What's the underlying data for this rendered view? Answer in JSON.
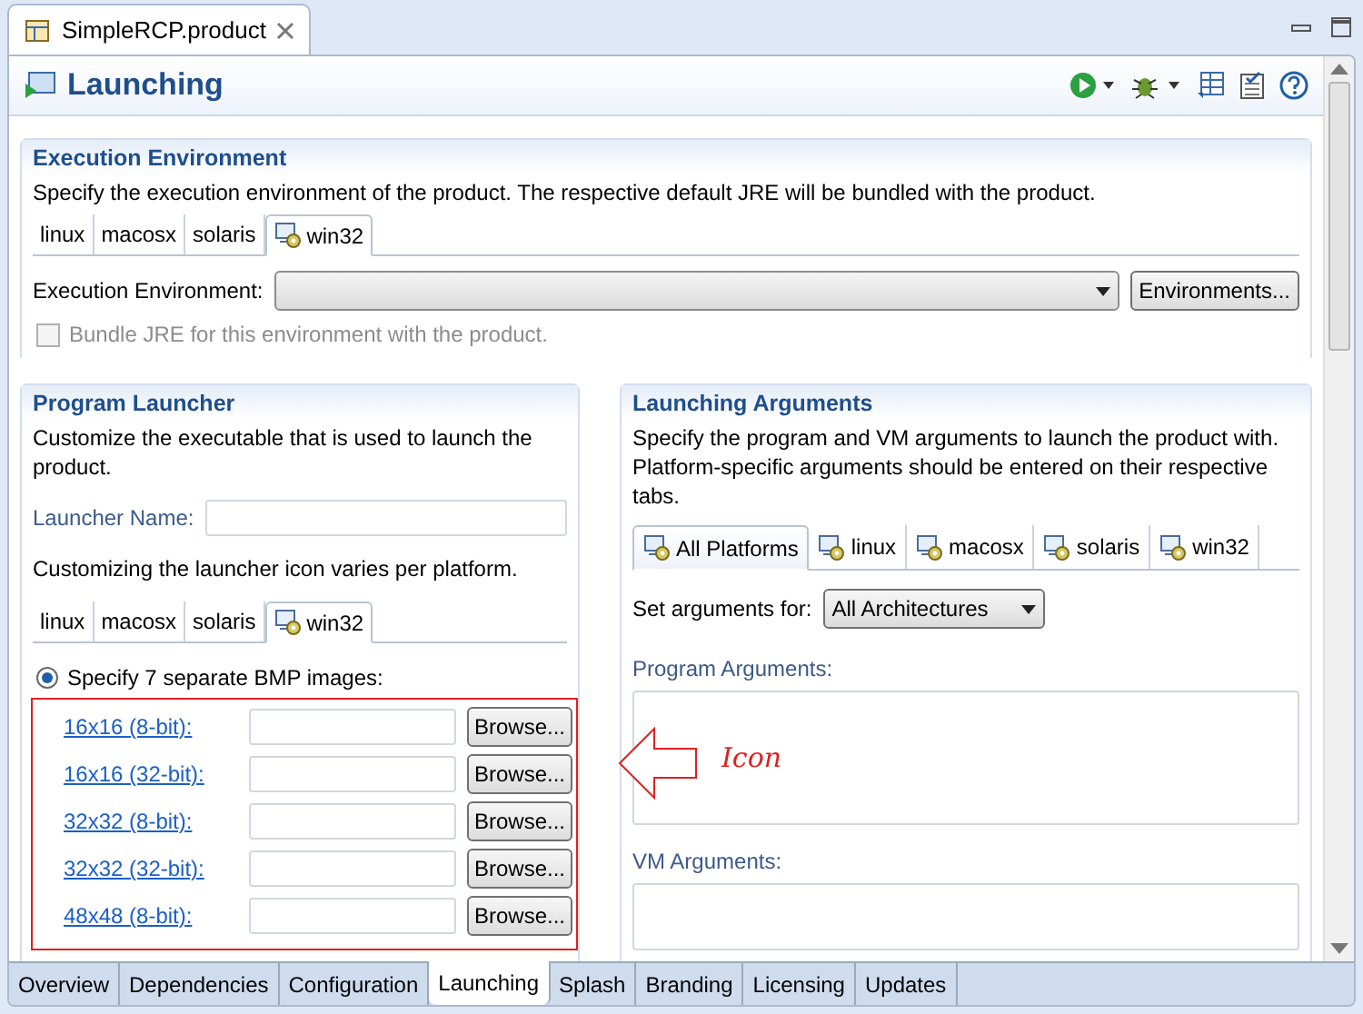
{
  "editor_tab": {
    "title": "SimpleRCP.product"
  },
  "form": {
    "title": "Launching"
  },
  "execution_environment": {
    "title": "Execution Environment",
    "description": "Specify the execution environment of the product. The respective default JRE will be bundled with the product.",
    "tabs": [
      {
        "label": "linux",
        "selected": false,
        "icon": false
      },
      {
        "label": "macosx",
        "selected": false,
        "icon": false
      },
      {
        "label": "solaris",
        "selected": false,
        "icon": false
      },
      {
        "label": "win32",
        "selected": true,
        "icon": true
      }
    ],
    "field_label": "Execution Environment:",
    "button": "Environments...",
    "bundle_jre": {
      "label": "Bundle JRE for this environment with the product.",
      "checked": false,
      "disabled": true
    }
  },
  "program_launcher": {
    "title": "Program Launcher",
    "description": "Customize the executable that is used to launch the product.",
    "launcher_name_label": "Launcher Name:",
    "icon_note": "Customizing the launcher icon varies per platform.",
    "tabs": [
      {
        "label": "linux",
        "selected": false,
        "icon": false
      },
      {
        "label": "macosx",
        "selected": false,
        "icon": false
      },
      {
        "label": "solaris",
        "selected": false,
        "icon": false
      },
      {
        "label": "win32",
        "selected": true,
        "icon": true
      }
    ],
    "radio": {
      "label": "Specify 7 separate BMP images:",
      "selected": true
    },
    "images": [
      {
        "label": "16x16 (8-bit):",
        "button": "Browse..."
      },
      {
        "label": "16x16 (32-bit):",
        "button": "Browse..."
      },
      {
        "label": "32x32 (8-bit):",
        "button": "Browse..."
      },
      {
        "label": "32x32 (32-bit):",
        "button": "Browse..."
      },
      {
        "label": "48x48 (8-bit):",
        "button": "Browse..."
      }
    ]
  },
  "annotation": {
    "label": "Icon"
  },
  "launching_arguments": {
    "title": "Launching Arguments",
    "description": "Specify the program and VM arguments to launch the product with. Platform-specific arguments should be entered on their respective tabs.",
    "tabs": [
      {
        "label": "All Platforms",
        "selected": true,
        "icon": true
      },
      {
        "label": "linux",
        "selected": false,
        "icon": true
      },
      {
        "label": "macosx",
        "selected": false,
        "icon": true
      },
      {
        "label": "solaris",
        "selected": false,
        "icon": true
      },
      {
        "label": "win32",
        "selected": false,
        "icon": true
      }
    ],
    "set_args_label": "Set arguments for:",
    "architecture": "All Architectures",
    "program_args_label": "Program Arguments:",
    "vm_args_label": "VM Arguments:"
  },
  "bottom_tabs": [
    {
      "label": "Overview",
      "selected": false
    },
    {
      "label": "Dependencies",
      "selected": false
    },
    {
      "label": "Configuration",
      "selected": false
    },
    {
      "label": "Launching",
      "selected": true
    },
    {
      "label": "Splash",
      "selected": false
    },
    {
      "label": "Branding",
      "selected": false
    },
    {
      "label": "Licensing",
      "selected": false
    },
    {
      "label": "Updates",
      "selected": false
    }
  ]
}
